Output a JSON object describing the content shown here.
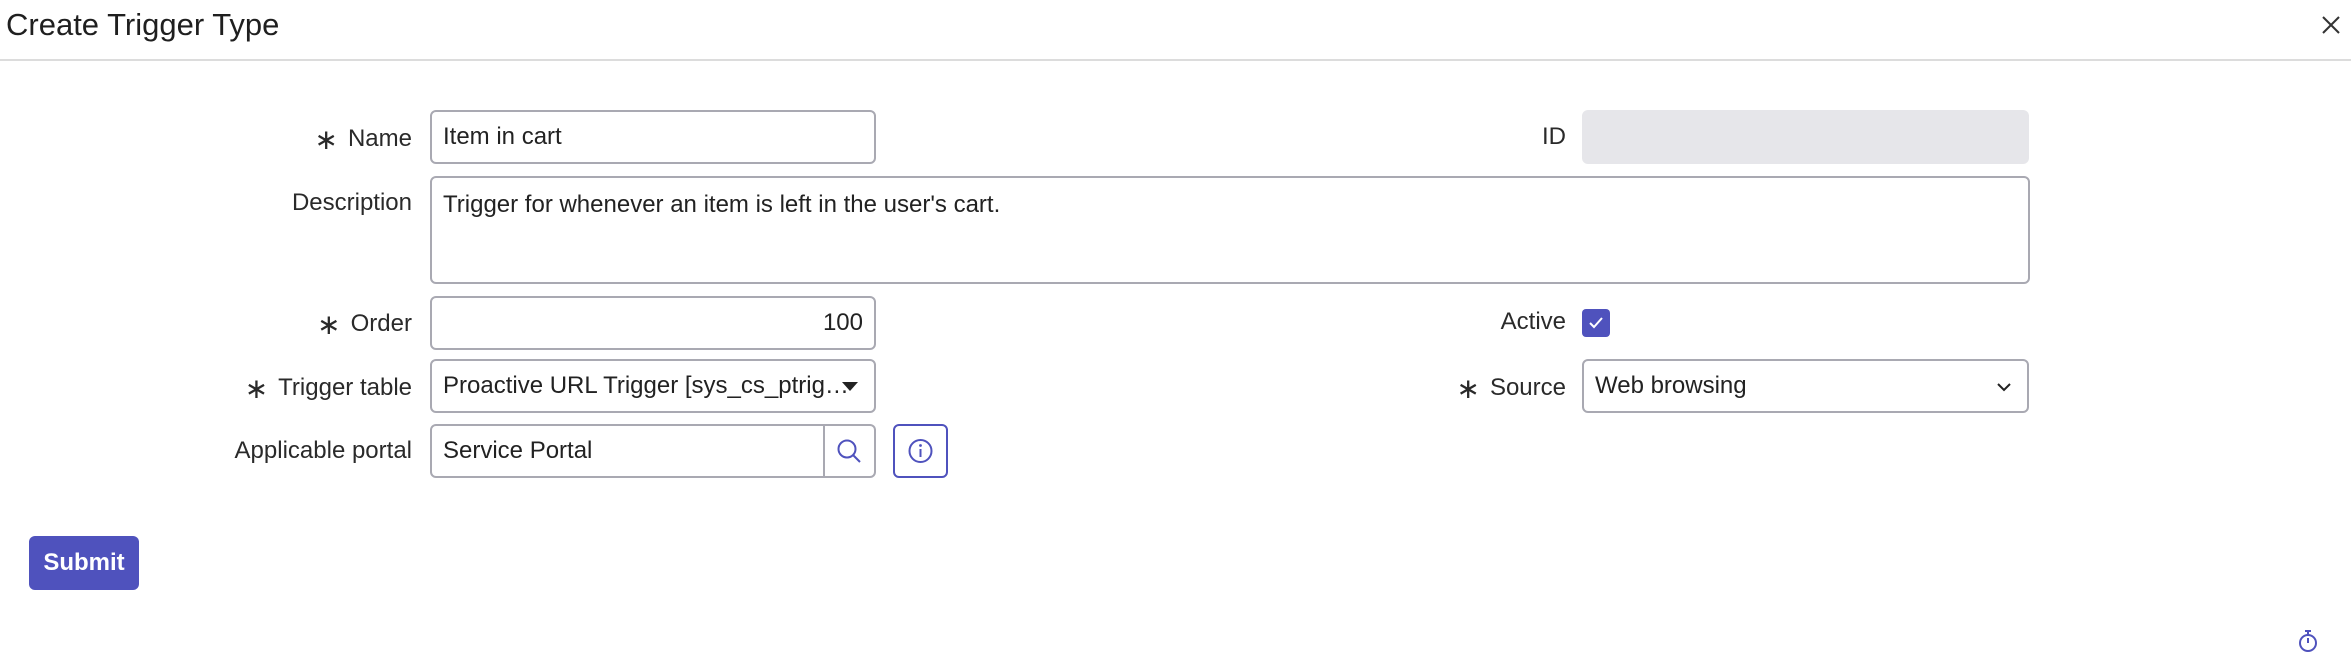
{
  "dialog": {
    "title": "Create Trigger Type",
    "close_icon": "close-icon"
  },
  "form": {
    "name": {
      "label": "Name",
      "required": true,
      "value": "Item in cart"
    },
    "id": {
      "label": "ID",
      "value": ""
    },
    "description": {
      "label": "Description",
      "value": "Trigger for whenever an item is left in the user's cart."
    },
    "order": {
      "label": "Order",
      "required": true,
      "value": "100"
    },
    "active": {
      "label": "Active",
      "checked": true
    },
    "trigger_table": {
      "label": "Trigger table",
      "required": true,
      "value": "Proactive URL Trigger [sys_cs_ptrig…"
    },
    "source": {
      "label": "Source",
      "required": true,
      "value": "Web browsing"
    },
    "applicable_portal": {
      "label": "Applicable portal",
      "value": "Service Portal"
    },
    "required_marker": "∗"
  },
  "actions": {
    "submit_label": "Submit"
  },
  "colors": {
    "accent": "#4f52bd",
    "border": "#a9a9b2",
    "readonly_bg": "#e6e6ea"
  }
}
